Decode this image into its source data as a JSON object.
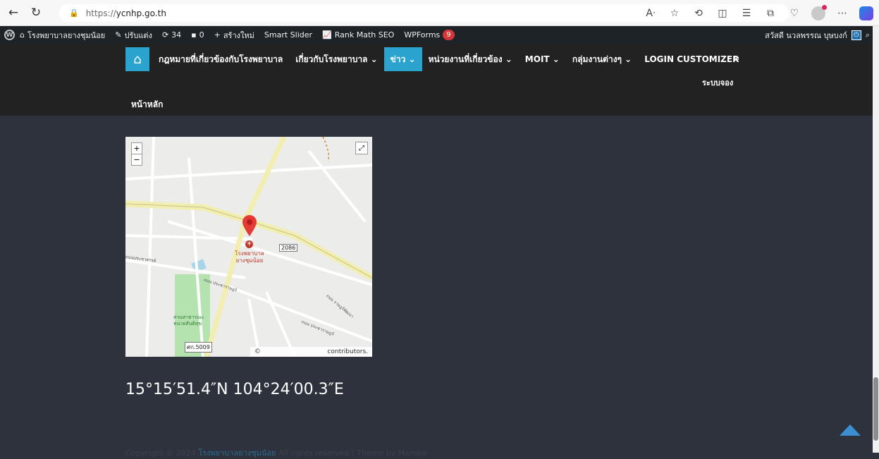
{
  "browser": {
    "url_scheme": "https://",
    "url_host": "ycnhp.go.th",
    "back_icon": "arrow-left-icon",
    "reload_icon": "reload-icon"
  },
  "admin_bar": {
    "site_name": "โรงพยาบาลยางชุมน้อย",
    "customize": "ปรับแต่ง",
    "updates": "34",
    "comments": "0",
    "new": "สร้างใหม่",
    "smart_slider": "Smart Slider",
    "rank_math": "Rank Math SEO",
    "wpforms": "WPForms",
    "wpforms_badge": "9",
    "greeting": "สวัสดี นวลพรรณ บุษบงก์"
  },
  "nav": {
    "items": [
      {
        "label": "กฎหมายที่เกี่ยวข้องกับโรงพยาบาล",
        "active": false
      },
      {
        "label": "เกี่ยวกับโรงพยาบาล ⌄",
        "active": false
      },
      {
        "label": "ข่าว ⌄",
        "active": true
      },
      {
        "label": "หน่วยงานที่เกี่ยวข้อง ⌄",
        "active": false
      },
      {
        "label": "MOIT ⌄",
        "active": false
      },
      {
        "label": "กลุ่มงานต่างๆ ⌄",
        "active": false
      },
      {
        "label": "LOGIN CUSTOMIZER",
        "active": false
      }
    ],
    "sub_item": "ระบบจอง",
    "home_link": "หน้าหลัก"
  },
  "map": {
    "zoom_in": "+",
    "zoom_out": "−",
    "hospital_label": "โรงพยาบาลยางชุมน้อย",
    "road_2086": "2086",
    "road_5009": "ศก.5009",
    "park_label": "สวนสาธารณะหน่วยสันติสุข",
    "street_1": "ถนนประชาสรรค์",
    "street_2": "ถนน ประชาราษฎร์",
    "street_3": "ถนน ราษฎร์พัฒนา",
    "street_4": "ถนน ประชาราษฎร์",
    "attribution_left": "©",
    "attribution_right": "contributors."
  },
  "coordinates": "15°15′51.4″N 104°24′00.3″E",
  "footer": {
    "prefix": "Copyright © 2024",
    "link": "โรงพยาบาลยางชุมน้อย",
    "suffix": "All rights reserved | Theme by Mamba"
  }
}
